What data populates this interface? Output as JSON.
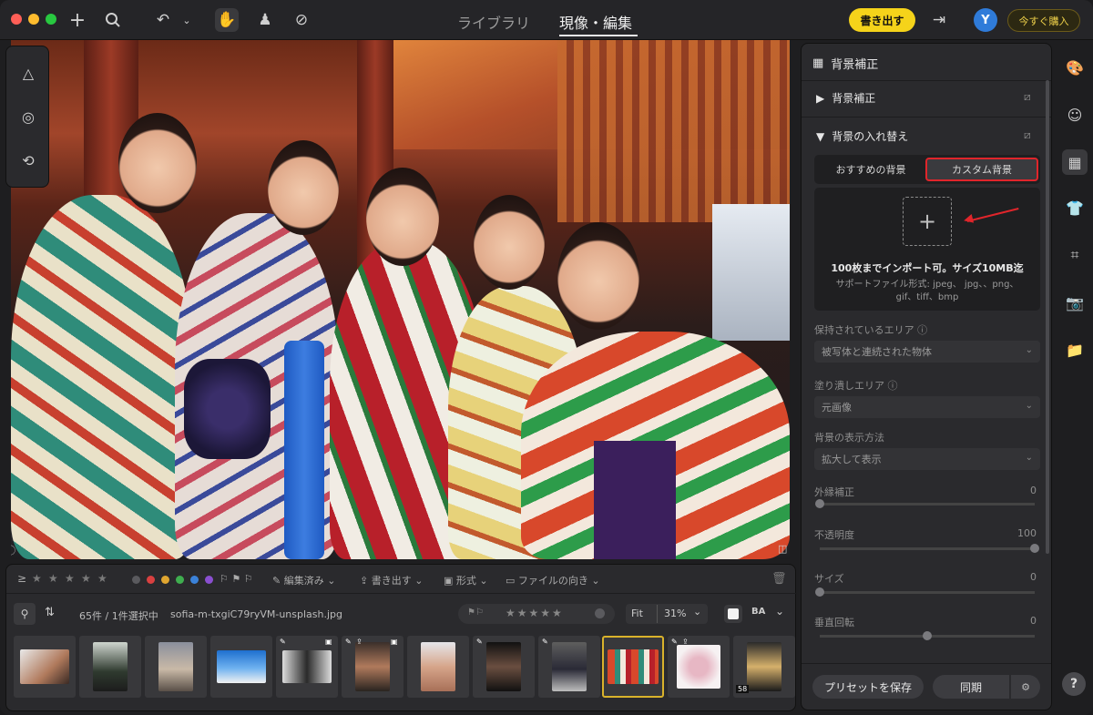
{
  "titlebar": {
    "tabs": [
      "ライブラリ",
      "現像・編集"
    ],
    "active_tab": "現像・編集",
    "export_label": "書き出す",
    "avatar_letter": "Y",
    "buy_label": "今すぐ購入",
    "icons": [
      "add-icon",
      "search-icon",
      "undo-icon",
      "chevron-down-icon",
      "hand-tool-icon",
      "stamp-tool-icon",
      "bandage-tool-icon",
      "exit-compare-icon"
    ]
  },
  "left_tools": [
    "ai-adjust-icon",
    "radial-mask-icon",
    "history-icon"
  ],
  "panel": {
    "title": "背景補正",
    "section1": "背景補正",
    "section2": "背景の入れ替え",
    "seg_recommended": "おすすめの背景",
    "seg_custom": "カスタム背景",
    "import_main": "100枚までインポート可。サイズ10MB迄",
    "import_sub": "サポートファイル形式: jpeg、 jpg、、png、 gif、tiff、bmp",
    "keep_area_label": "保持されているエリア",
    "keep_area_value": "被写体と連続された物体",
    "fill_area_label": "塗り潰しエリア",
    "fill_area_value": "元画像",
    "display_label": "背景の表示方法",
    "display_value": "拡大して表示",
    "sliders": [
      {
        "label": "外縁補正",
        "value": "0",
        "fraction": 0.0
      },
      {
        "label": "不透明度",
        "value": "100",
        "fraction": 1.0
      },
      {
        "label": "サイズ",
        "value": "0",
        "fraction": 0.0
      },
      {
        "label": "垂直回転",
        "value": "0",
        "fraction": 0.5
      }
    ],
    "save_preset": "プリセットを保存",
    "sync": "同期"
  },
  "right_rail": [
    "palette-icon",
    "portrait-icon",
    "background-icon",
    "clothing-icon",
    "crop-icon",
    "camera-icon",
    "folder-icon"
  ],
  "filmstrip": {
    "filter_prefix": "≥",
    "menus": [
      "編集済み",
      "書き出す",
      "形式",
      "ファイルの向き"
    ],
    "count_text": "65件 / 1件選択中",
    "filename": "sofia-m-txgiC79ryVM-unsplash.jpg",
    "zoom_fit": "Fit",
    "zoom_value": "31%",
    "ba_label": "BA",
    "last_thumb_badge": "58",
    "label_colors": [
      "#5a5a5e",
      "#d94040",
      "#e0a630",
      "#3fae4f",
      "#3b82d9",
      "#8a4fd0"
    ]
  }
}
